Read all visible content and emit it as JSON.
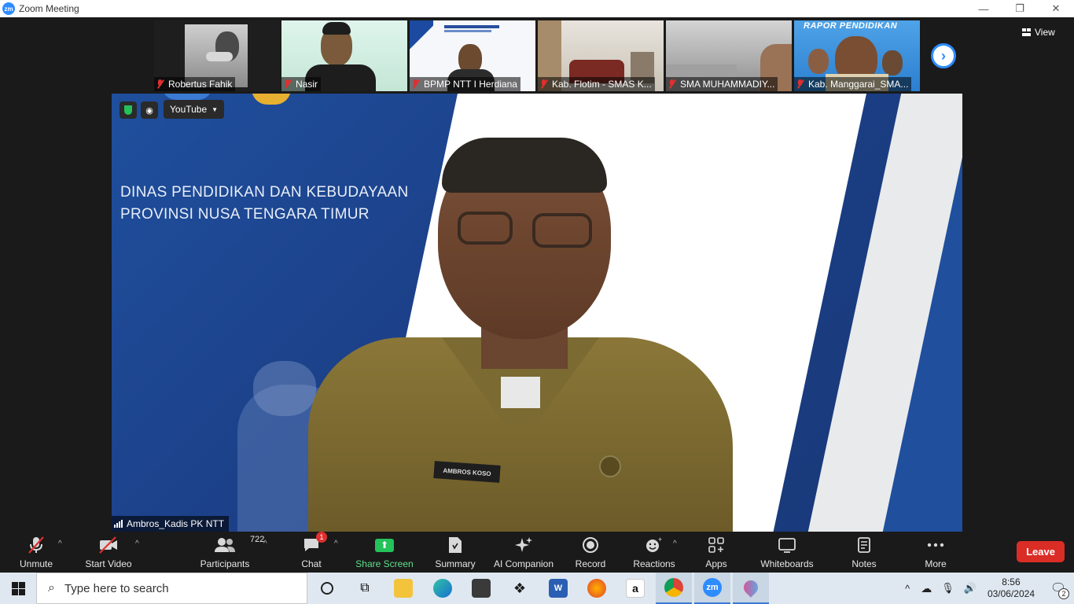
{
  "window": {
    "title": "Zoom Meeting",
    "minimize": "—",
    "restore": "❐",
    "close": "✕",
    "logo_text": "zm"
  },
  "thumbnails": [
    {
      "name": "Robertus Fahik",
      "muted": true
    },
    {
      "name": "Nasir",
      "muted": true
    },
    {
      "name": "BPMP NTT I Herdiana",
      "muted": true
    },
    {
      "name": "Kab. Flotim - SMAS K...",
      "muted": true
    },
    {
      "name": "SMA MUHAMMADIY...",
      "muted": true
    },
    {
      "name": "Kab. Manggarai_SMA...",
      "muted": true
    }
  ],
  "thumb_texts": {
    "rapor": "RAPOR PENDIDIKAN"
  },
  "view_button": {
    "label": "View"
  },
  "main_video": {
    "background_text_line1": "DINAS PENDIDIKAN DAN KEBUDAYAAN",
    "background_text_line2": "PROVINSI NUSA TENGARA TIMUR",
    "youtube_label": "YouTube",
    "speaker_name": "Ambros_Kadis PK NTT",
    "name_tag": "AMBROS KOSO"
  },
  "toolbar": {
    "unmute": "Unmute",
    "start_video": "Start Video",
    "participants": "Participants",
    "participants_count": "722",
    "chat": "Chat",
    "chat_badge": "1",
    "share_screen": "Share Screen",
    "summary": "Summary",
    "ai_companion": "AI Companion",
    "record": "Record",
    "reactions": "Reactions",
    "apps": "Apps",
    "whiteboards": "Whiteboards",
    "notes": "Notes",
    "more": "More",
    "leave": "Leave"
  },
  "taskbar": {
    "search_placeholder": "Type here to search",
    "time": "8:56",
    "date": "03/06/2024",
    "notification_count": "2"
  },
  "colors": {
    "zoom_blue": "#2d8cff",
    "leave_red": "#d92d26",
    "share_green": "#23c25b",
    "muted_red": "#e02f2f"
  }
}
